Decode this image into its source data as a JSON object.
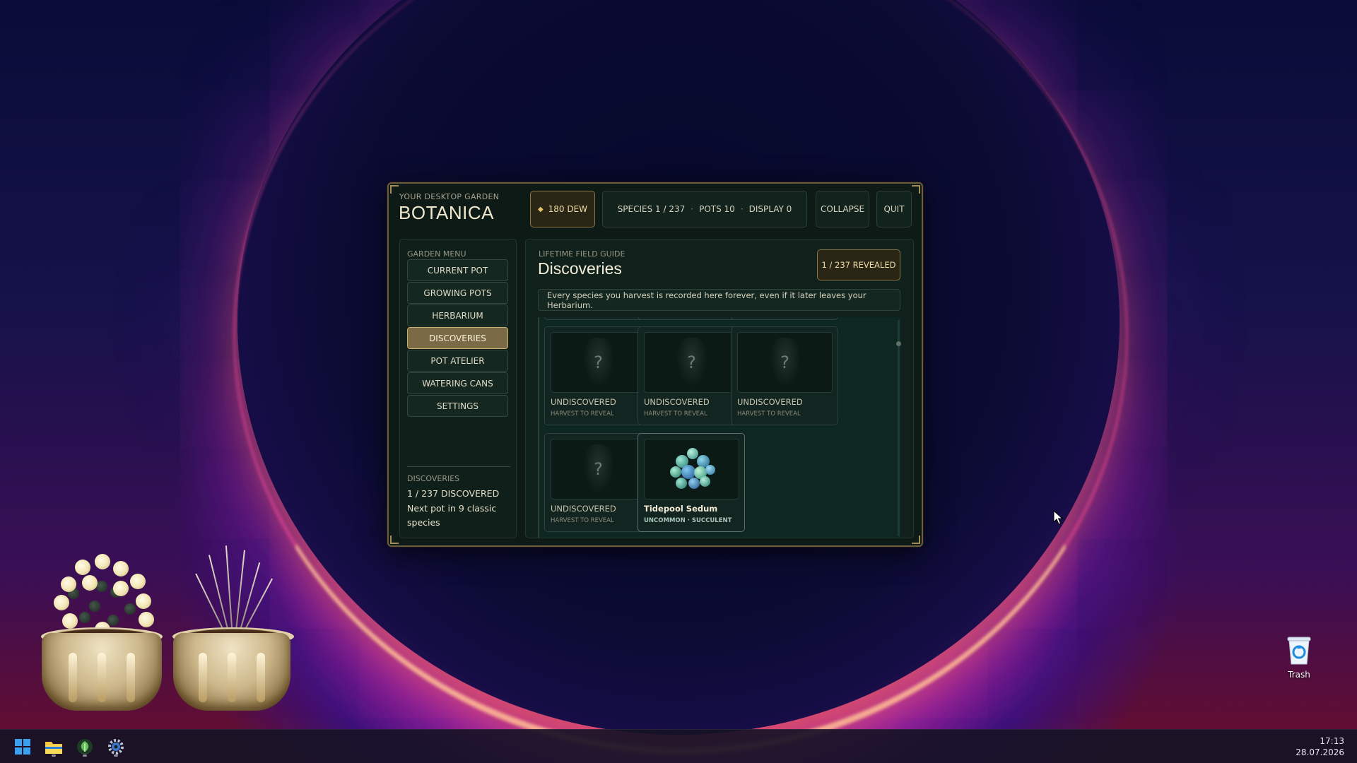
{
  "app": {
    "brand_subtitle": "YOUR DESKTOP GARDEN",
    "brand_title": "BOTANICA",
    "dew_label": "180 DEW",
    "stats": {
      "species": "SPECIES 1 / 237",
      "pots": "POTS 10",
      "display": "DISPLAY 0"
    },
    "collapse_label": "COLLAPSE",
    "quit_label": "QUIT"
  },
  "sidebar": {
    "heading": "GARDEN MENU",
    "items": [
      {
        "label": "CURRENT POT",
        "active": false
      },
      {
        "label": "GROWING POTS",
        "active": false
      },
      {
        "label": "HERBARIUM",
        "active": false
      },
      {
        "label": "DISCOVERIES",
        "active": true
      },
      {
        "label": "POT ATELIER",
        "active": false
      },
      {
        "label": "WATERING CANS",
        "active": false
      },
      {
        "label": "SETTINGS",
        "active": false
      }
    ],
    "summary_heading": "DISCOVERIES",
    "summary_count": "1 / 237 DISCOVERED",
    "summary_next": "Next pot in 9 classic species"
  },
  "main": {
    "subtitle": "LIFETIME FIELD GUIDE",
    "title": "Discoveries",
    "revealed_badge": "1 / 237 REVEALED",
    "description": "Every species you harvest is recorded here forever, even if it later leaves your Herbarium.",
    "cards": [
      {
        "name": "UNDISCOVERED",
        "meta": "HARVEST TO REVEAL",
        "placeholder": "?",
        "found": false
      },
      {
        "name": "UNDISCOVERED",
        "meta": "HARVEST TO REVEAL",
        "placeholder": "?",
        "found": false
      },
      {
        "name": "UNDISCOVERED",
        "meta": "HARVEST TO REVEAL",
        "placeholder": "?",
        "found": false
      },
      {
        "name": "UNDISCOVERED",
        "meta": "HARVEST TO REVEAL",
        "placeholder": "?",
        "found": false
      },
      {
        "name": "Tidepool Sedum",
        "meta": "UNCOMMON · SUCCULENT",
        "placeholder": "",
        "found": true
      }
    ]
  },
  "desktop": {
    "trash_label": "Trash"
  },
  "taskbar": {
    "icons": [
      "windows-start-icon",
      "file-explorer-icon",
      "botanica-app-icon",
      "settings-gear-icon"
    ],
    "time": "17:13",
    "date": "28.07.2026"
  },
  "colors": {
    "accent_gold": "#c9ad6e",
    "panel_bg": "#0d1a16",
    "active_menu": "#7a6a45"
  }
}
